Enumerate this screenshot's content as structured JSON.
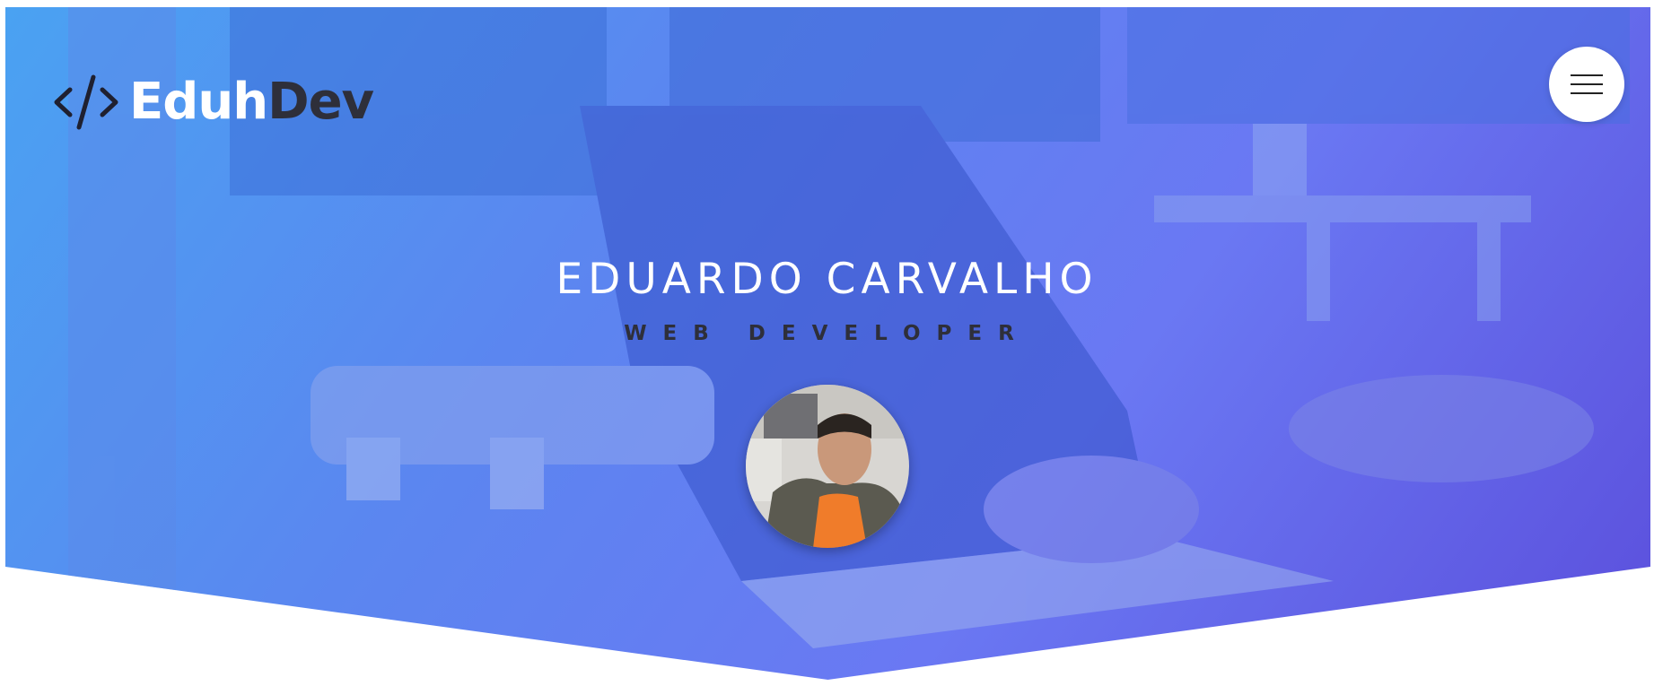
{
  "brand": {
    "name_part1": "Eduh",
    "name_part2": "Dev",
    "icon": "code-brackets-icon"
  },
  "header": {
    "menu_icon": "hamburger-menu-icon"
  },
  "hero": {
    "name": "EDUARDO CARVALHO",
    "role": "WEB DEVELOPER",
    "avatar_alt": "profile-photo"
  },
  "colors": {
    "gradient_start": "#4aa2f2",
    "gradient_end": "#5b4fdc",
    "dark_text": "#2e2f3a",
    "white": "#ffffff"
  }
}
